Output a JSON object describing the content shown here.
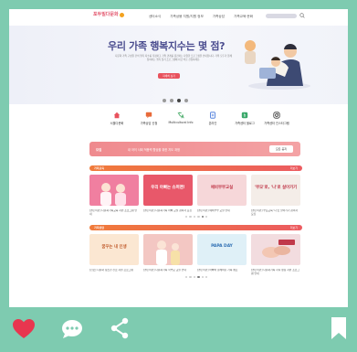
{
  "header": {
    "logo_text": "포두밀다문화",
    "nav": [
      "센터소식",
      "가족상봉 지원/지원 정보",
      "가족상담",
      "가족교육·문화"
    ]
  },
  "hero": {
    "title": "우리 가족 행복지수는 몇 점?",
    "description": "다문화 가족 구성원 간의 행복 지수를 측정하고 가족 관계를 증진하는 다양한 프로그램을 안내합니다. 가족 모두가 함께 참여하는 행복 찾기 프로그램에 지금 바로 신청하세요.",
    "button": "자세히 보기",
    "slides": 4,
    "active_slide": 3
  },
  "quick_links": [
    {
      "label": "서울다문화",
      "icon": "house-icon",
      "color": "#e8525d"
    },
    {
      "label": "가족상담 신청",
      "icon": "chat-icon",
      "color": "#e86a3a"
    },
    {
      "label": "Multicultural Info",
      "icon": "translate-icon",
      "color": "#3aa55d"
    },
    {
      "label": "온라인",
      "icon": "document-icon",
      "color": "#3a6fd8"
    },
    {
      "label": "가족센터 블로그",
      "icon": "blog-icon",
      "color": "#3aa86a"
    },
    {
      "label": "가족센터 인스타그램",
      "icon": "instagram-icon",
      "color": "#333333"
    }
  ],
  "notice": {
    "label": "모집",
    "text": "내 아이 사회 적응력 향상을 위한 지도 과정",
    "button": "모든 공지"
  },
  "section1": {
    "title": "가족교육",
    "more": "더보기",
    "cards": [
      {
        "title": "",
        "caption": "[결혼이민] 다문화가족교육 지원 프로그램 안내",
        "color": "#f07fa0",
        "text_color": "#ffffff"
      },
      {
        "title": "우리 아빠는 슈퍼맨!",
        "caption": "[결혼이민] 다문화가족 아빠 교실 참여자 모집",
        "color": "#e8586a",
        "text_color": "#ffffff"
      },
      {
        "title": "예비부부교실",
        "caption": "[결혼이민] 예비부부 교실 안내",
        "color": "#f6d7d9",
        "text_color": "#c0394a"
      },
      {
        "title": "'부모'로, '나'로 살아가기",
        "caption": "[결혼이민] 부모교육 '나'로 살아가기 참여자 모집",
        "color": "#f4ede8",
        "text_color": "#c0394a"
      }
    ],
    "dots": 6,
    "active_dot": 5
  },
  "section2": {
    "title": "가족상담",
    "more": "더보기",
    "cards": [
      {
        "title": "꿈꾸는 내 인생",
        "caption": "[진로] 다문화 청소년 진로 지원 프로그램",
        "color": "#fbe7d2",
        "text_color": "#c05a2a"
      },
      {
        "title": "",
        "caption": "[결혼이민] 다문화가족 학부모 교실 안내",
        "color": "#f3c7c3",
        "text_color": "#ffffff"
      },
      {
        "title": "PAPA DAY",
        "caption": "[결혼이민] 아빠와 함께하는 가족 캠프",
        "color": "#dff0f7",
        "text_color": "#2f6fb3"
      },
      {
        "title": "",
        "caption": "[결혼이민] 다문화가족 자녀 성장 지원 프로그램 안내",
        "color": "#f2dcdf",
        "text_color": "#c0394a"
      }
    ],
    "dots": 6,
    "active_dot": 4
  },
  "colors": {
    "background": "#7ecbb0",
    "accent": "#e8525d",
    "section_gradient": [
      "#f07a3a",
      "#ec5b60"
    ]
  },
  "bottom_bar": {
    "icons": [
      "heart-icon",
      "comment-icon",
      "share-icon",
      "bookmark-icon"
    ]
  }
}
